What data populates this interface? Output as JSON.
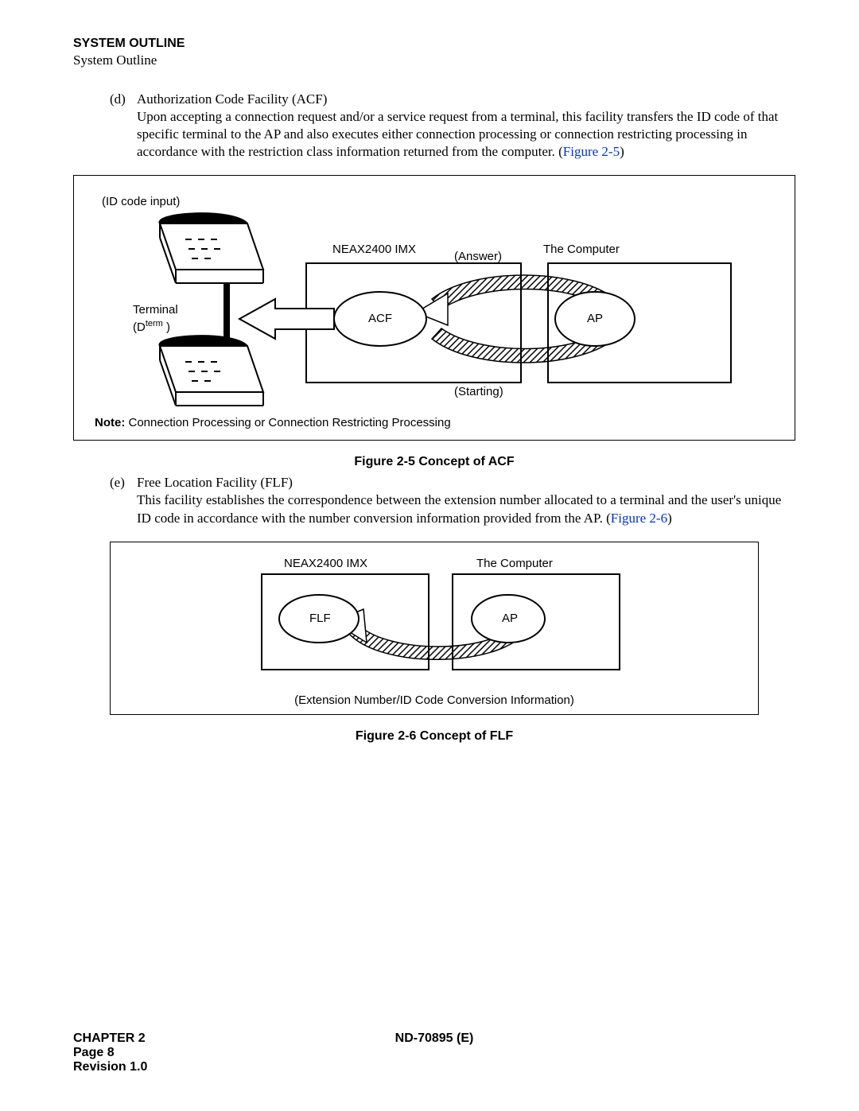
{
  "header": {
    "title_bold": "SYSTEM OUTLINE",
    "subtitle": "System Outline"
  },
  "item_d": {
    "marker": "(d)",
    "title": "Authorization Code Facility (ACF)",
    "body": "Upon accepting a connection request and/or a service request from a terminal, this facility transfers the ID code of that specific terminal to the AP and also executes either connection processing or connection restricting processing in accordance with the restriction class information returned from the computer. (",
    "figref": "Figure 2-5",
    "tail": ")"
  },
  "fig1": {
    "id_code": "(ID code input)",
    "neax": "NEAX2400 IMX",
    "computer": "The Computer",
    "answer": "(Answer)",
    "starting": "(Starting)",
    "terminal": "Terminal",
    "dterm_pre": "(D",
    "dterm_sup": "term",
    "dterm_post": "     )",
    "acf": "ACF",
    "ap": "AP",
    "note_label": "Note:",
    "note_body": " Connection Processing or Connection Restricting Processing",
    "caption": "Figure 2-5   Concept of ACF"
  },
  "item_e": {
    "marker": "(e)",
    "title": "Free Location Facility (FLF)",
    "body": "This facility establishes the correspondence between the extension number allocated to a terminal and the user's unique ID code in accordance with the number conversion information provided from the AP. (",
    "figref": "Figure 2-6",
    "tail": ")"
  },
  "fig2": {
    "neax": "NEAX2400 IMX",
    "computer": "The Computer",
    "flf": "FLF",
    "ap": "AP",
    "bottom": "(Extension Number/ID Code Conversion Information)",
    "caption": "Figure 2-6   Concept of FLF"
  },
  "footer": {
    "chapter": "CHAPTER 2",
    "docnum": "ND-70895 (E)",
    "page": "Page 8",
    "rev": "Revision 1.0"
  }
}
